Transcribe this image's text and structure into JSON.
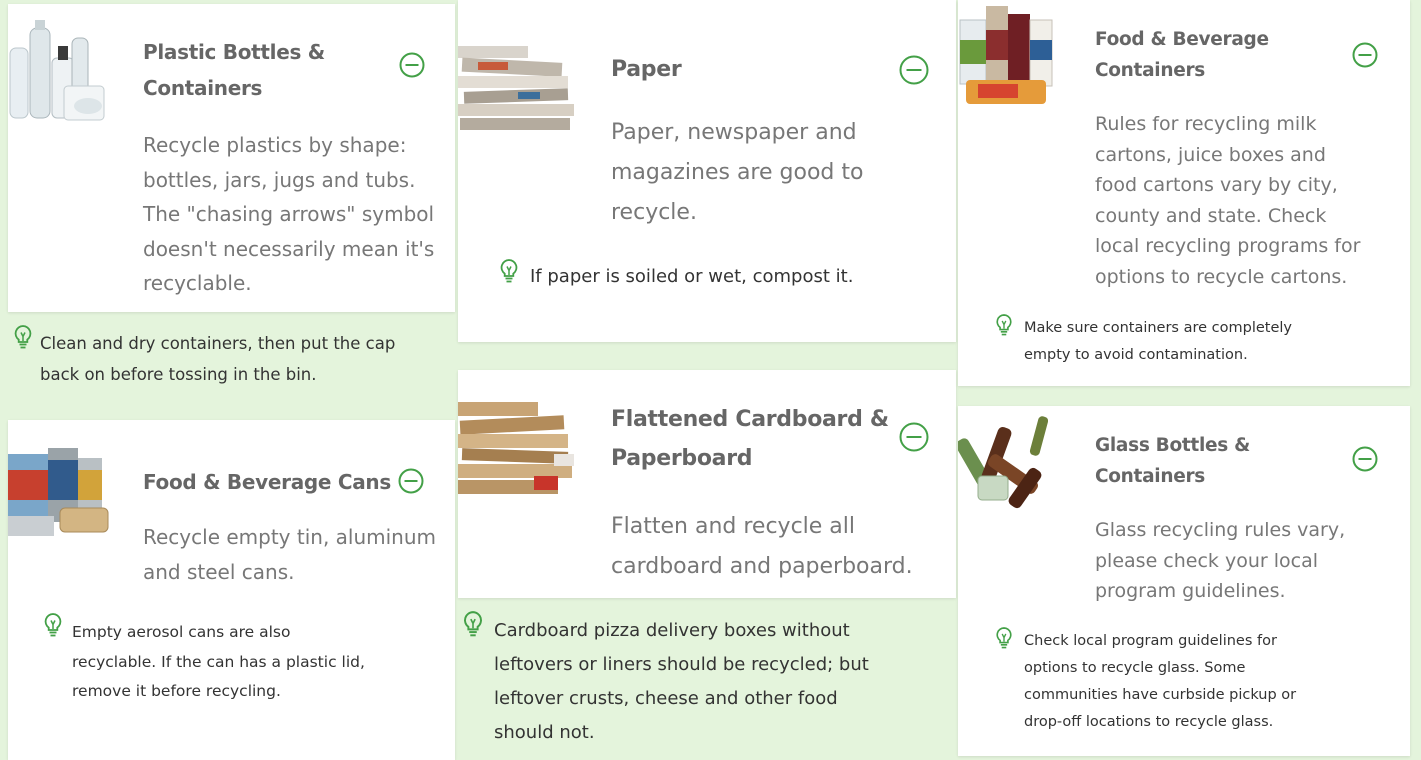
{
  "colors": {
    "accent": "#43a047",
    "tip_bg": "#e4f4dc",
    "card_bg": "#ffffff"
  },
  "icons": {
    "toggle": "minus-circle-icon",
    "tip": "lightbulb-icon"
  },
  "items": {
    "plastic": {
      "title_line1": "Plastic Bottles &",
      "title_line2": "Containers",
      "desc": [
        "Recycle plastics by shape:",
        "bottles, jars, jugs and tubs.",
        "The \"chasing arrows\" symbol",
        "doesn't necessarily mean it's",
        "recyclable."
      ],
      "tip": [
        "Clean and dry containers, then put the cap",
        "back on before tossing in the bin."
      ]
    },
    "paper": {
      "title": "Paper",
      "desc": [
        "Paper, newspaper and",
        "magazines are good to",
        "recycle."
      ],
      "tip": "If paper is soiled or wet, compost it."
    },
    "food_bev_containers": {
      "title_line1": "Food & Beverage",
      "title_line2": "Containers",
      "desc": [
        "Rules for recycling milk",
        "cartons, juice boxes and",
        "food cartons vary by city,",
        "county and state. Check",
        "local recycling programs for",
        "options to recycle cartons."
      ],
      "tip": [
        "Make sure containers are completely",
        "empty to avoid contamination."
      ]
    },
    "cans": {
      "title": "Food & Beverage Cans",
      "desc": [
        "Recycle empty tin, aluminum",
        "and steel cans."
      ],
      "tip": [
        "Empty aerosol cans are also",
        "recyclable. If the can has a plastic lid,",
        "remove it before recycling."
      ]
    },
    "cardboard": {
      "title_line1": "Flattened Cardboard &",
      "title_line2": "Paperboard",
      "desc": [
        "Flatten and recycle all",
        "cardboard and paperboard."
      ],
      "tip": [
        "Cardboard pizza delivery boxes without",
        "leftovers or liners should be recycled; but",
        "leftover crusts, cheese and other food",
        "should not."
      ]
    },
    "glass": {
      "title_line1": "Glass Bottles &",
      "title_line2": "Containers",
      "desc": [
        "Glass recycling rules vary,",
        "please check your local",
        "program guidelines."
      ],
      "tip": [
        "Check local program guidelines for",
        "options to recycle glass. Some",
        "communities have curbside pickup or",
        "drop-off locations to recycle glass."
      ]
    }
  }
}
